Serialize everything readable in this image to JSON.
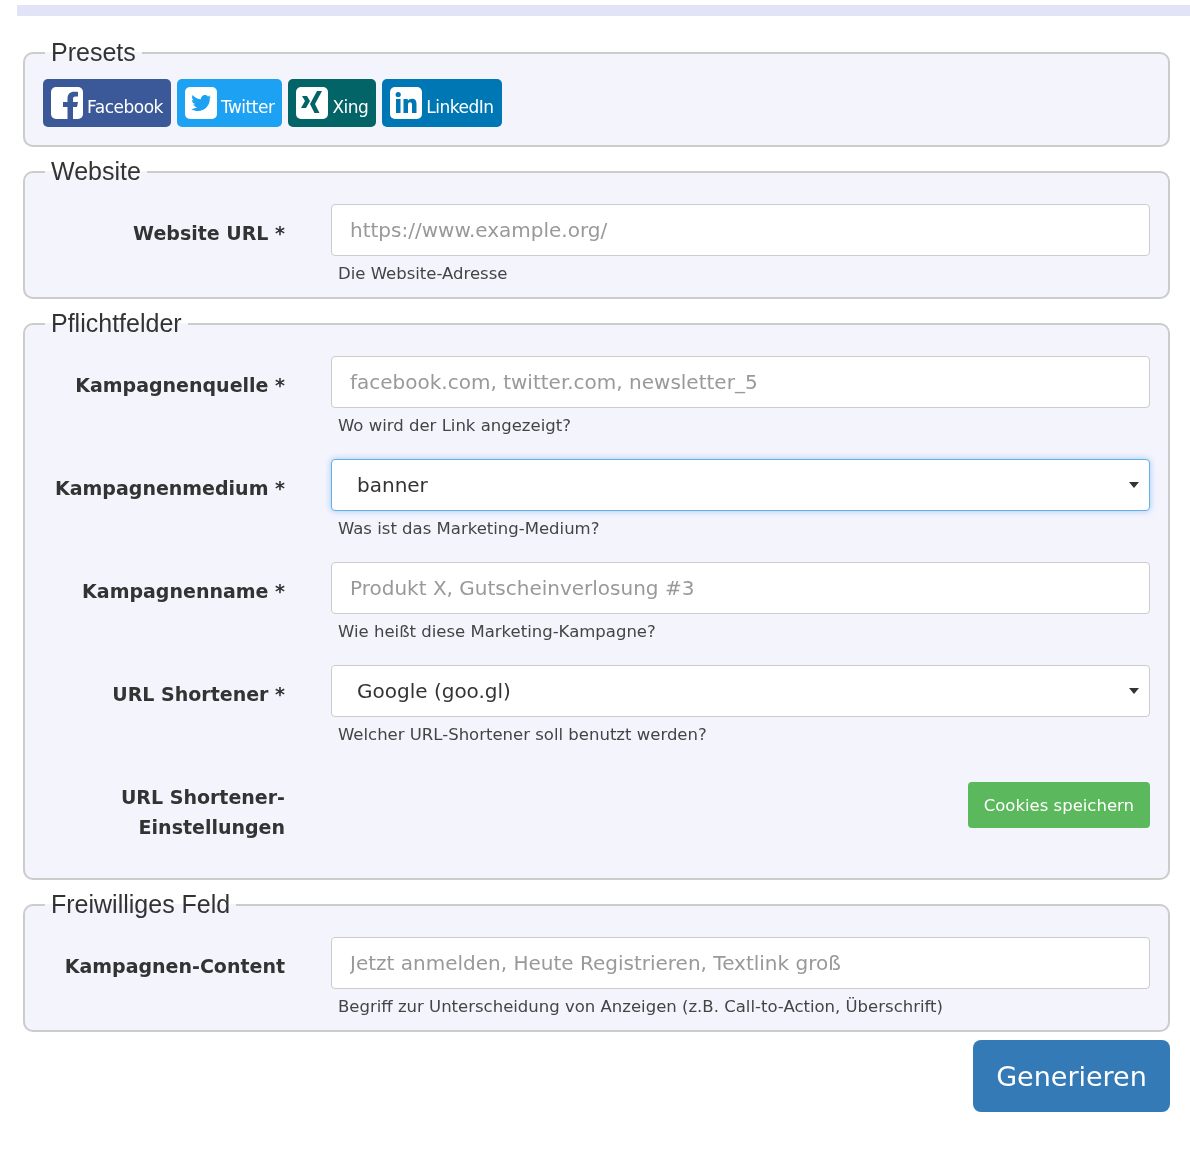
{
  "presets": {
    "legend": "Presets",
    "buttons": [
      {
        "label": "Facebook",
        "kind": "facebook",
        "color": "#3b5998"
      },
      {
        "label": "Twitter",
        "kind": "twitter",
        "color": "#1da1f2"
      },
      {
        "label": "Xing",
        "kind": "xing",
        "color": "#026466"
      },
      {
        "label": "LinkedIn",
        "kind": "linkedin",
        "color": "#0077b5"
      }
    ]
  },
  "sections": [
    {
      "legend": "Website",
      "rows": [
        {
          "kind": "text",
          "label": "Website URL *",
          "placeholder": "https://www.example.org/",
          "help": "Die Website-Adresse",
          "focused": false
        }
      ]
    },
    {
      "legend": "Pflichtfelder",
      "rows": [
        {
          "kind": "text",
          "label": "Kampagnenquelle *",
          "placeholder": "facebook.com, twitter.com, newsletter_5",
          "help": "Wo wird der Link angezeigt?",
          "focused": false
        },
        {
          "kind": "select",
          "label": "Kampagnenmedium *",
          "value": "banner",
          "help": "Was ist das Marketing-Medium?",
          "focused": true
        },
        {
          "kind": "text",
          "label": "Kampagnenname *",
          "placeholder": "Produkt X, Gutscheinverlosung #3",
          "help": "Wie heißt diese Marketing-Kampagne?",
          "focused": false
        },
        {
          "kind": "select",
          "label": "URL Shortener *",
          "value": "Google (goo.gl)",
          "help": "Welcher URL-Shortener soll benutzt werden?",
          "focused": false
        },
        {
          "kind": "button",
          "label": "URL Shortener-Einstellungen",
          "button": "Cookies speichern"
        }
      ]
    },
    {
      "legend": "Freiwilliges Feld",
      "rows": [
        {
          "kind": "text",
          "label": "Kampagnen-Content",
          "placeholder": "Jetzt anmelden, Heute Registrieren, Textlink groß",
          "help": "Begriff zur Unterscheidung von Anzeigen (z.B. Call-to-Action, Überschrift)",
          "focused": false
        }
      ]
    }
  ],
  "submit": "Generieren"
}
